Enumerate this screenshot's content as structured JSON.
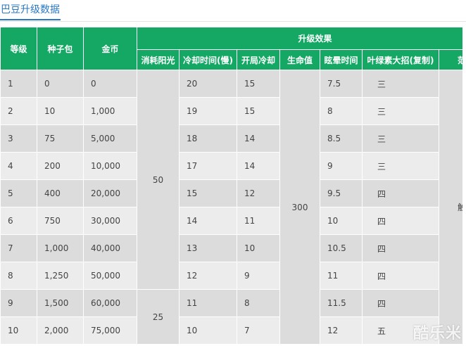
{
  "header": {
    "title": "巴豆升级数据"
  },
  "table": {
    "group_header": "升级效果",
    "columns": {
      "level": "等级",
      "seed_pack": "种子包",
      "gold": "金币",
      "sun_cost": "消耗阳光",
      "cooldown": "冷却时间(慢)",
      "start_cooldown": "开局冷却",
      "hp": "生命值",
      "stun_time": "眩晕时间",
      "skill": "叶绿素大招(复制)",
      "range": "范围"
    },
    "rows": [
      {
        "level": "1",
        "seed_pack": "0",
        "gold": "0",
        "cooldown": "20",
        "start_cooldown": "15",
        "stun_time": "7.5",
        "skill": "三"
      },
      {
        "level": "2",
        "seed_pack": "10",
        "gold": "1,000",
        "cooldown": "19",
        "start_cooldown": "15",
        "stun_time": "8",
        "skill": "三"
      },
      {
        "level": "3",
        "seed_pack": "75",
        "gold": "5,000",
        "cooldown": "18",
        "start_cooldown": "14",
        "stun_time": "8.5",
        "skill": "三"
      },
      {
        "level": "4",
        "seed_pack": "200",
        "gold": "10,000",
        "cooldown": "17",
        "start_cooldown": "14",
        "stun_time": "9",
        "skill": "三"
      },
      {
        "level": "5",
        "seed_pack": "400",
        "gold": "20,000",
        "cooldown": "15",
        "start_cooldown": "12",
        "stun_time": "9.5",
        "skill": "四"
      },
      {
        "level": "6",
        "seed_pack": "750",
        "gold": "30,000",
        "cooldown": "14",
        "start_cooldown": "11",
        "stun_time": "10",
        "skill": "四"
      },
      {
        "level": "7",
        "seed_pack": "1,000",
        "gold": "40,000",
        "cooldown": "13",
        "start_cooldown": "10",
        "stun_time": "10.5",
        "skill": "四"
      },
      {
        "level": "8",
        "seed_pack": "1,250",
        "gold": "50,000",
        "cooldown": "12",
        "start_cooldown": "9",
        "stun_time": "11",
        "skill": "四"
      },
      {
        "level": "9",
        "seed_pack": "1,500",
        "gold": "60,000",
        "cooldown": "11",
        "start_cooldown": "8",
        "stun_time": "11.5",
        "skill": "四"
      },
      {
        "level": "10",
        "seed_pack": "2,000",
        "gold": "75,000",
        "cooldown": "10",
        "start_cooldown": "7",
        "stun_time": "12",
        "skill": "五"
      }
    ],
    "merged": {
      "sun_cost_group1": "50",
      "sun_cost_group2": "25",
      "hp_all": "300",
      "range_all": "触碰"
    }
  },
  "watermark": "酷乐米",
  "colors": {
    "header_green": "#14a864",
    "title_blue": "#2a78c2",
    "row_odd": "#dcdcdc",
    "row_even": "#ececec"
  }
}
